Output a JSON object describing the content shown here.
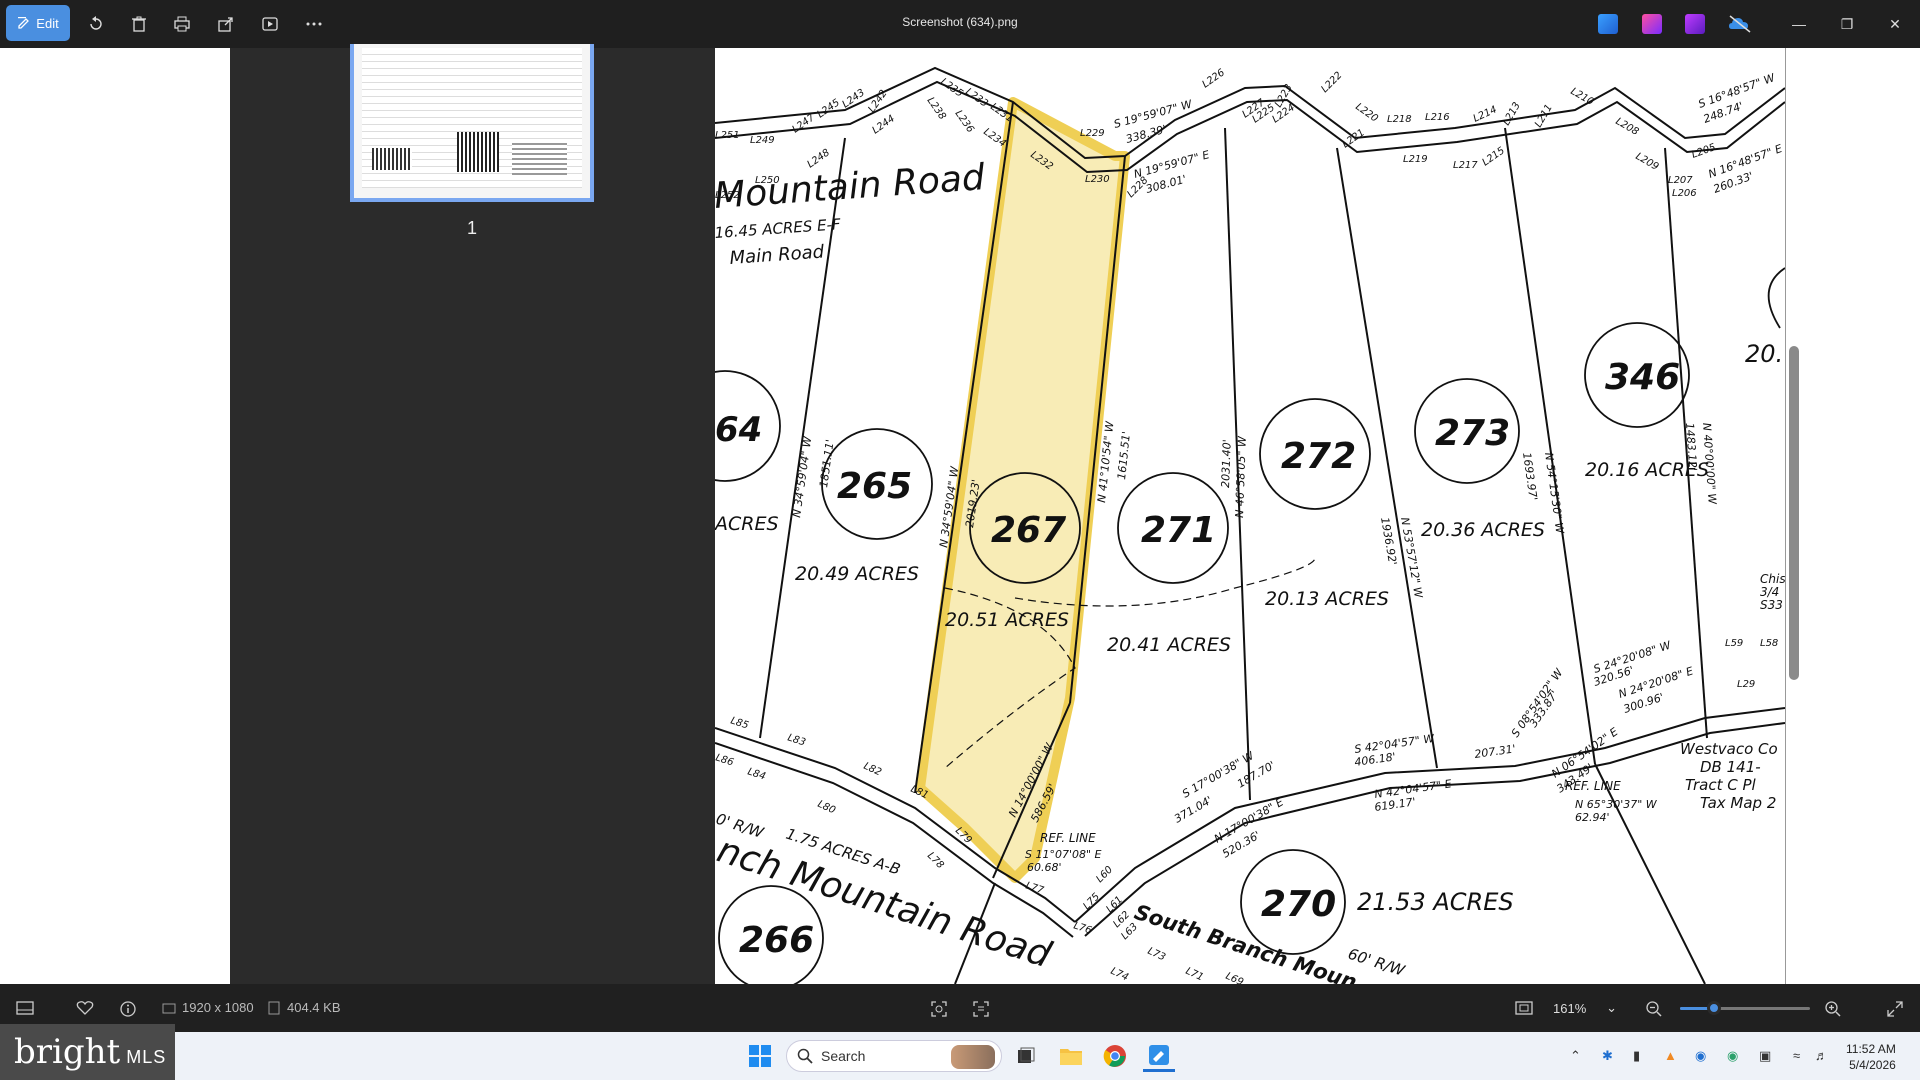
{
  "window": {
    "title": "Screenshot (634).png",
    "edit_label": "Edit"
  },
  "thumbnail": {
    "page_number": "1"
  },
  "status": {
    "dimensions": "1920 x 1080",
    "file_size": "404.4 KB",
    "zoom": "161%",
    "zoom_level": 0.26
  },
  "taskbar": {
    "search_placeholder": "Search",
    "time": "11:52 AM",
    "date": "5/4/2026",
    "watermark_brand": "bright",
    "watermark_suffix": "MLS"
  },
  "map": {
    "road_top": "Mountain Road",
    "road_top_acres": "16.45 ACRES E-F",
    "road_top_sub": "Main Road",
    "road_bottom": "nch Mountain Road",
    "road_bottom_acres": "1.75 ACRES A-B",
    "road_bottom_rw": "0' R/W",
    "south_branch": "South Branch Moun",
    "south_branch_rw": "60' R/W",
    "westvaco_1": "Westvaco Co",
    "westvaco_2": "DB 141-",
    "westvaco_3": "Tract C Pl",
    "westvaco_4": "Tax Map 2",
    "chis_1": "Chis",
    "chis_2": "3/4",
    "chis_3": "S33",
    "ref_line_1": "REF. LINE",
    "ref_line_2": "REF. LINE",
    "lots": [
      {
        "num": "64",
        "acres": "ACRES"
      },
      {
        "num": "265",
        "acres": "20.49 ACRES"
      },
      {
        "num": "267",
        "acres": "20.51 ACRES"
      },
      {
        "num": "271",
        "acres": "20.41 ACRES"
      },
      {
        "num": "272",
        "acres": "20.13 ACRES"
      },
      {
        "num": "273",
        "acres": "20.36 ACRES"
      },
      {
        "num": "346",
        "acres": "20.16 ACRES"
      },
      {
        "num": "270",
        "acres": "21.53 ACRES"
      },
      {
        "num": "266",
        "acres": ""
      }
    ],
    "edge_acres": "20.",
    "bearings": [
      "N 34°59'04\" W",
      "1851.11'",
      "N 34°59'04\" W",
      "2019.23'",
      "N 41°10'54\" W",
      "1615.51'",
      "N 46°58'05\" W",
      "2031.40'",
      "N 53°57'12\" W",
      "1936.92'",
      "N 54°15'30\" W",
      "1693.97'",
      "N 40°00'00\" W",
      "1483.12'",
      "N 14°00'00\" W",
      "586.59'",
      "S 19°59'07\" W",
      "338.39'",
      "N 19°59'07\" E",
      "308.01'",
      "S 42°04'57\" W",
      "406.18'",
      "207.31'",
      "N 42°04'57\" E",
      "619.17'",
      "S 17°00'38\" W",
      "187.70'",
      "371.04'",
      "N 17°00'38\" E",
      "520.36'",
      "S 24°20'08\" W",
      "320.56'",
      "N 24°20'08\" E",
      "300.96'",
      "S 08°54'02\" W",
      "333.87'",
      "N 06°54'02\" E",
      "343.49'",
      "N 65°30'37\" W",
      "62.94'",
      "S 11°07'08\" E",
      "60.68'",
      "S 16°48'57\" W",
      "248.74'",
      "N 16°48'57\" E",
      "260.33'"
    ],
    "line_labels": [
      "L249",
      "L247",
      "L245",
      "L243",
      "L235",
      "L233",
      "L231",
      "L229",
      "L226",
      "L227",
      "L224",
      "L222",
      "L220",
      "L218",
      "L216",
      "L214",
      "L213",
      "L211",
      "L210",
      "L208",
      "L207",
      "L206",
      "L205",
      "L209",
      "L215",
      "L217",
      "L219",
      "L221",
      "L223",
      "L225",
      "L228",
      "L230",
      "L232",
      "L234",
      "L236",
      "L238",
      "L242",
      "L244",
      "L248",
      "L250",
      "L252",
      "L251",
      "L85",
      "L83",
      "L82",
      "L81",
      "L80",
      "L79",
      "L78",
      "L77",
      "L76",
      "L75",
      "L74",
      "L73",
      "L71",
      "L69",
      "L60",
      "L61",
      "L62",
      "L63",
      "L84",
      "L86",
      "L59",
      "L58",
      "L29"
    ]
  }
}
